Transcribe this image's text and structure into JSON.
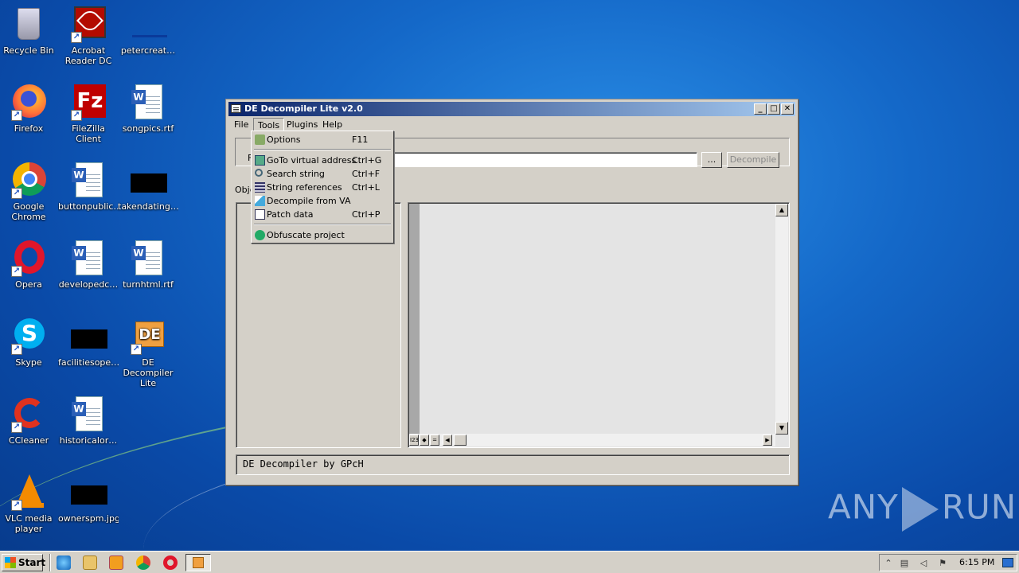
{
  "desktop": {
    "icons": [
      {
        "label": "Recycle Bin",
        "icon": "recycle-bin-icon"
      },
      {
        "label": "Acrobat\nReader DC",
        "icon": "acrobat-icon"
      },
      {
        "label": "petercreat…",
        "icon": "file-icon"
      },
      {
        "label": "Firefox",
        "icon": "firefox-icon"
      },
      {
        "label": "FileZilla Client",
        "icon": "filezilla-icon"
      },
      {
        "label": "songpics.rtf",
        "icon": "word-doc-icon"
      },
      {
        "label": "Google\nChrome",
        "icon": "chrome-icon"
      },
      {
        "label": "buttonpublic…",
        "icon": "word-doc-icon"
      },
      {
        "label": "takendating…",
        "icon": "black-file-icon"
      },
      {
        "label": "Opera",
        "icon": "opera-icon"
      },
      {
        "label": "developedc…",
        "icon": "word-doc-icon"
      },
      {
        "label": "turnhtml.rtf",
        "icon": "word-doc-icon"
      },
      {
        "label": "Skype",
        "icon": "skype-icon"
      },
      {
        "label": "facilitiesope…",
        "icon": "black-file-icon"
      },
      {
        "label": "DE Decompiler\nLite",
        "icon": "de-decompiler-icon"
      },
      {
        "label": "CCleaner",
        "icon": "ccleaner-icon"
      },
      {
        "label": "historicalor…",
        "icon": "word-doc-icon"
      },
      {
        "label": "VLC media\nplayer",
        "icon": "vlc-icon"
      },
      {
        "label": "ownerspm.jpg",
        "icon": "black-file-icon"
      }
    ]
  },
  "window": {
    "title": "DE Decompiler Lite v2.0",
    "controls": {
      "minimize": "_",
      "maximize": "□",
      "close": "✕"
    },
    "menu": [
      "File",
      "Tools",
      "Plugins",
      "Help"
    ],
    "browse_button": "...",
    "decompile_button": "Decompile",
    "path_label_partial": "F",
    "objects_label_partial": "Obje",
    "status_text": "DE Decompiler by GPcH",
    "path_value": ""
  },
  "tools_menu": {
    "items": [
      {
        "label": "Options",
        "shortcut": "F11",
        "icon": "options-icon"
      },
      {
        "label": "GoTo virtual address",
        "shortcut": "Ctrl+G",
        "icon": "goto-icon"
      },
      {
        "label": "Search string",
        "shortcut": "Ctrl+F",
        "icon": "search-icon"
      },
      {
        "label": "String references",
        "shortcut": "Ctrl+L",
        "icon": "list-icon"
      },
      {
        "label": "Decompile from VA",
        "shortcut": "",
        "icon": "decompile-icon"
      },
      {
        "label": "Patch data",
        "shortcut": "Ctrl+P",
        "icon": "patch-icon"
      },
      {
        "label": "Obfuscate project",
        "shortcut": "",
        "icon": "obfuscate-icon"
      }
    ]
  },
  "taskbar": {
    "start_label": "Start",
    "clock": "6:15 PM"
  },
  "watermark": {
    "left": "ANY",
    "right": "RUN"
  }
}
